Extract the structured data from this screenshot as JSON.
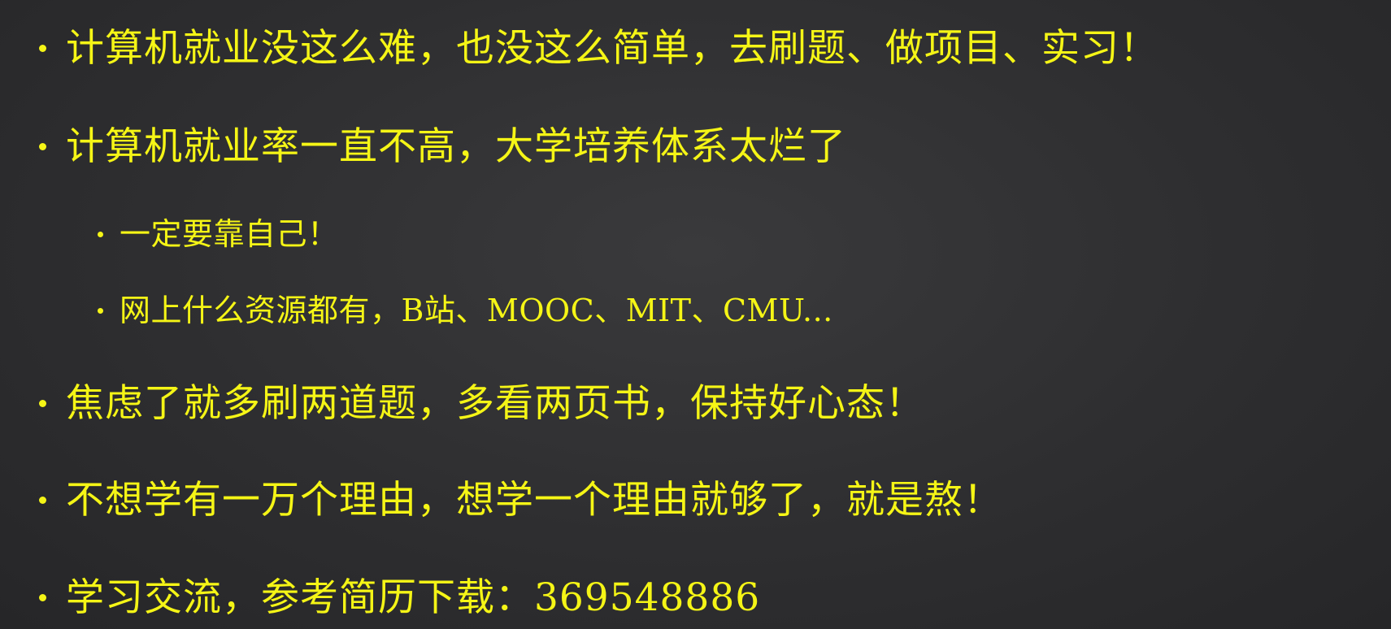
{
  "bullets": [
    {
      "text": "计算机就业没这么难，也没这么简单，去刷题、做项目、实习！"
    },
    {
      "text": "计算机就业率一直不高，大学培养体系太烂了"
    },
    {
      "text": "一定要靠自己！"
    },
    {
      "text": "网上什么资源都有，B站、MOOC、MIT、CMU..."
    },
    {
      "text": "焦虑了就多刷两道题，多看两页书，保持好心态！"
    },
    {
      "text": "不想学有一万个理由，想学一个理由就够了，就是熬！"
    },
    {
      "text": "学习交流，参考简历下载：369548886"
    }
  ],
  "colors": {
    "text": "#f5f516",
    "background": "#2e2e30"
  }
}
